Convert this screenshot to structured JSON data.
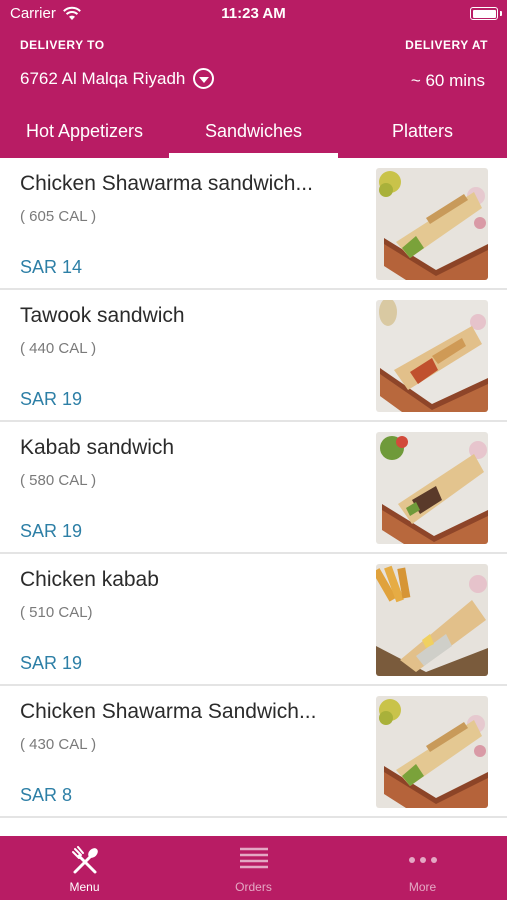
{
  "status_bar": {
    "carrier": "Carrier",
    "time": "11:23 AM"
  },
  "header": {
    "delivery_to_label": "DELIVERY TO",
    "address": "6762 Al Malqa Riyadh",
    "delivery_at_label": "DELIVERY AT",
    "eta": "~ 60 mins"
  },
  "tabs": [
    {
      "label": "Hot Appetizers"
    },
    {
      "label": "Sandwiches",
      "active": true
    },
    {
      "label": "Platters"
    }
  ],
  "items": [
    {
      "name": "Chicken Shawarma sandwich...",
      "calories": "( 605 CAL )",
      "price": "SAR 14"
    },
    {
      "name": "Tawook sandwich",
      "calories": "( 440 CAL )",
      "price": "SAR 19"
    },
    {
      "name": "Kabab sandwich",
      "calories": "( 580 CAL )",
      "price": "SAR 19"
    },
    {
      "name": "Chicken kabab",
      "calories": "( 510 CAL)",
      "price": "SAR 19"
    },
    {
      "name": "Chicken Shawarma Sandwich...",
      "calories": "( 430 CAL )",
      "price": "SAR 8"
    }
  ],
  "tabbar": [
    {
      "label": "Menu",
      "icon": "fork-spoon-icon",
      "active": true
    },
    {
      "label": "Orders",
      "icon": "list-lines-icon"
    },
    {
      "label": "More",
      "icon": "more-dots-icon"
    }
  ],
  "colors": {
    "brand": "#B81C64",
    "price": "#2D7FA6",
    "divider": "#e4e4e4"
  }
}
